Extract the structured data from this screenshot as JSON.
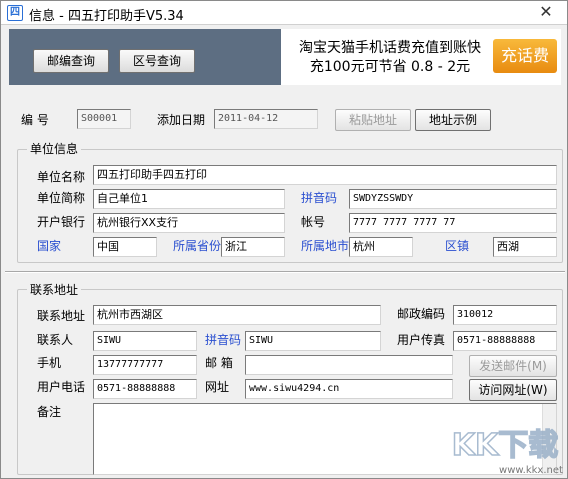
{
  "window": {
    "title": "信息 - 四五打印助手V5.34",
    "app_icon": "app-icon",
    "close_glyph": "✕"
  },
  "toolbar": {
    "zip_query": "邮编查询",
    "area_query": "区号查询"
  },
  "ad": {
    "line1": "淘宝天猫手机话费充值到账快",
    "line2": "充100元可节省 0.8 - 2元",
    "button": "充话费"
  },
  "header": {
    "number_label": "编    号",
    "number_value": "S00001",
    "date_label": "添加日期",
    "date_value": "2011-04-12",
    "paste_button": "粘贴地址",
    "sample_button": "地址示例"
  },
  "unit": {
    "group_title": "单位信息",
    "name_label": "单位名称",
    "name_value": "四五打印助手四五打印",
    "short_label": "单位简称",
    "short_value": "自己单位1",
    "pinyin_label": "拼音码",
    "pinyin_value": "SWDYZSSWDY",
    "bank_label": "开户银行",
    "bank_value": "杭州银行XX支行",
    "account_label": "帐号",
    "account_value": "7777 7777 7777 77",
    "country_label": "国家",
    "country_value": "中国",
    "province_label": "所属省份",
    "province_value": "浙江",
    "city_label": "所属地市",
    "city_value": "杭州",
    "district_label": "区镇",
    "district_value": "西湖"
  },
  "contact": {
    "group_title": "联系地址",
    "address_label": "联系地址",
    "address_value": "杭州市西湖区",
    "postcode_label": "邮政编码",
    "postcode_value": "310012",
    "person_label": "联系人",
    "person_value": "SIWU",
    "pinyin_label": "拼音码",
    "pinyin_value": "SIWU",
    "fax_label": "用户传真",
    "fax_value": "0571-88888888",
    "mobile_label": "手机",
    "mobile_value": "13777777777",
    "email_label": "邮  箱",
    "email_value": "",
    "send_mail_button": "发送邮件(M)",
    "phone_label": "用户电话",
    "phone_value": "0571-88888888",
    "website_label": "网址",
    "website_value": "www.siwu4294.cn",
    "visit_button": "访问网址(W)",
    "note_label": "备注",
    "note_value": ""
  },
  "watermark": {
    "brand": "KK下载",
    "url": "www.kkx.net"
  },
  "colors": {
    "toolbar_bg": "#5d6e82",
    "accent_blue": "#2a4fd0",
    "ad_button": "#f0a020"
  }
}
